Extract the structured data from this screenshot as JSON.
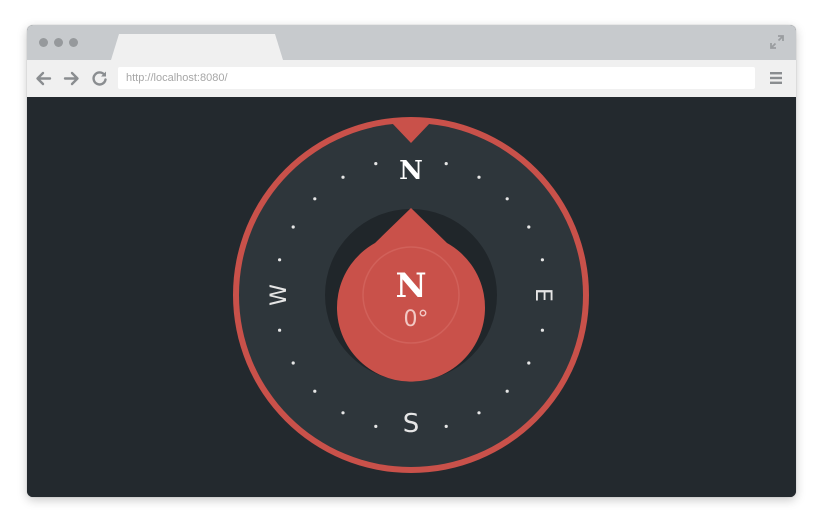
{
  "browser": {
    "url": "http://localhost:8080/",
    "icons": {
      "back": "arrow-left-icon",
      "forward": "arrow-right-icon",
      "reload": "reload-icon",
      "menu": "hamburger-menu-icon",
      "expand": "expand-icon"
    }
  },
  "compass": {
    "cardinals": {
      "north": "N",
      "east": "E",
      "south": "S",
      "west": "W"
    },
    "heading_letter": "N",
    "heading_degrees": "0°",
    "colors": {
      "accent": "#c9514a",
      "dial": "#2e363b",
      "inner": "#20262a",
      "background": "#23292e",
      "text": "#ffffff"
    }
  }
}
